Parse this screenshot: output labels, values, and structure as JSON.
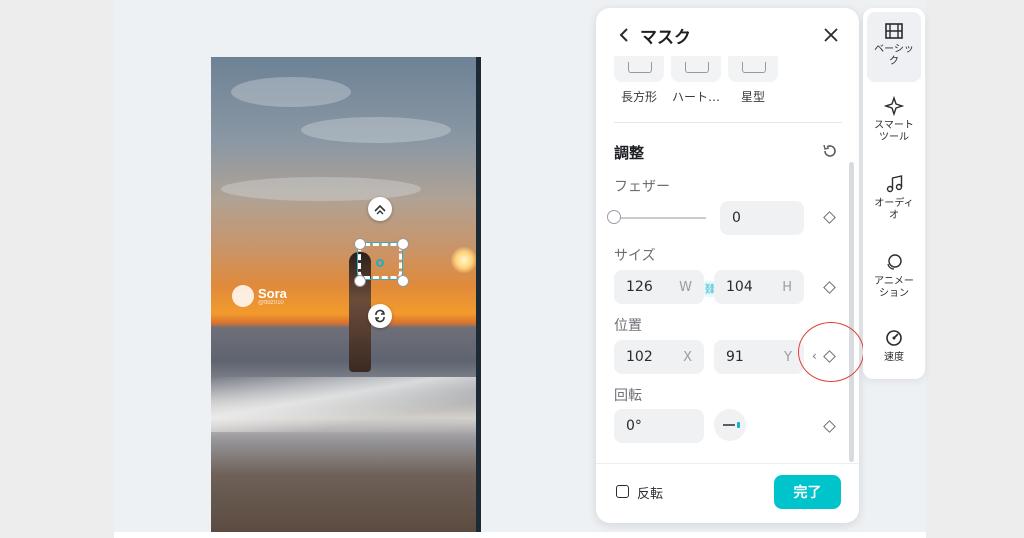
{
  "watermark": {
    "name": "Sora",
    "handle": "@ttdz010"
  },
  "panel": {
    "title": "マスク",
    "shapes": [
      "長方形",
      "ハート…",
      "星型"
    ],
    "section_title": "調整",
    "feather": {
      "label": "フェザー",
      "value": "0",
      "level": 0
    },
    "size": {
      "label": "サイズ",
      "w_value": "126",
      "w_unit": "W",
      "h_value": "104",
      "h_unit": "H"
    },
    "position": {
      "label": "位置",
      "x_value": "102",
      "x_unit": "X",
      "y_value": "91",
      "y_unit": "Y"
    },
    "rotation": {
      "label": "回転",
      "value": "0°"
    },
    "flip_label": "反転",
    "done_label": "完了"
  },
  "toolbar": {
    "items": [
      {
        "label": "ベーシック",
        "icon": "film-icon",
        "active": true
      },
      {
        "label": "スマートツール",
        "icon": "sparkle-icon",
        "active": false
      },
      {
        "label": "オーディオ",
        "icon": "music-note-icon",
        "active": false
      },
      {
        "label": "アニメーション",
        "icon": "animation-icon",
        "active": false
      },
      {
        "label": "速度",
        "icon": "speedometer-icon",
        "active": false
      }
    ]
  },
  "colors": {
    "accent": "#00c4cc",
    "annotation": "#e0403a"
  }
}
